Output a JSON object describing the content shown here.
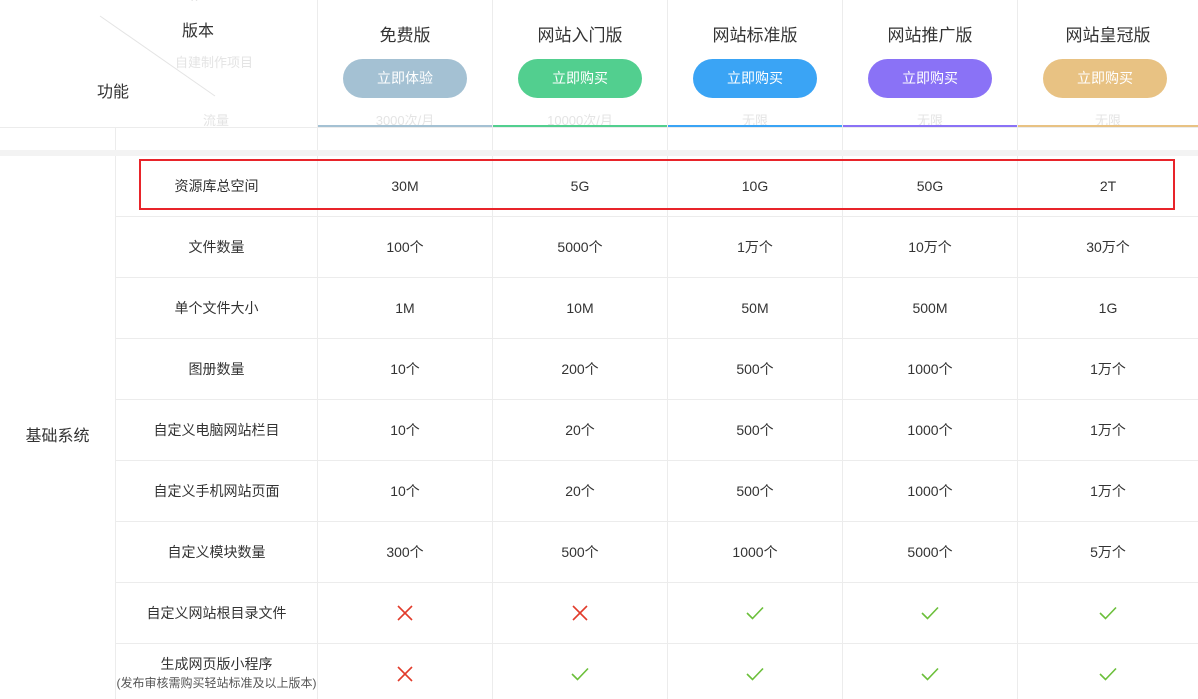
{
  "header": {
    "corner": {
      "version_label": "版本",
      "function_label": "功能",
      "ghost_text": "自建制作项目",
      "ghost_text_2": "流量"
    },
    "plans": [
      {
        "name": "免费版",
        "button": "立即体验",
        "button_color": "#a4c1d3",
        "line_color": "#a4c1d3",
        "ghost": "3000次/月"
      },
      {
        "name": "网站入门版",
        "button": "立即购买",
        "button_color": "#52cf8f",
        "line_color": "#52cf8f",
        "ghost": "10000次/月"
      },
      {
        "name": "网站标准版",
        "button": "立即购买",
        "button_color": "#3aa4f5",
        "line_color": "#3aa4f5",
        "ghost": "无限"
      },
      {
        "name": "网站推广版",
        "button": "立即购买",
        "button_color": "#8a72f6",
        "line_color": "#8a72f6",
        "ghost": "无限"
      },
      {
        "name": "网站皇冠版",
        "button": "立即购买",
        "button_color": "#e8c283",
        "line_color": "#e8c283",
        "ghost": "无限"
      }
    ]
  },
  "category": "基础系统",
  "icons": {
    "cross": "cross-icon",
    "check": "check-icon",
    "cross_color": "#e23b2b",
    "check_color": "#6bbf3a"
  },
  "highlight_color": "#e8242a",
  "rows": [
    {
      "feature": "资源库总空间",
      "values": [
        "30M",
        "5G",
        "10G",
        "50G",
        "2T"
      ]
    },
    {
      "feature": "文件数量",
      "values": [
        "100个",
        "5000个",
        "1万个",
        "10万个",
        "30万个"
      ]
    },
    {
      "feature": "单个文件大小",
      "values": [
        "1M",
        "10M",
        "50M",
        "500M",
        "1G"
      ]
    },
    {
      "feature": "图册数量",
      "values": [
        "10个",
        "200个",
        "500个",
        "1000个",
        "1万个"
      ]
    },
    {
      "feature": "自定义电脑网站栏目",
      "values": [
        "10个",
        "20个",
        "500个",
        "1000个",
        "1万个"
      ]
    },
    {
      "feature": "自定义手机网站页面",
      "values": [
        "10个",
        "20个",
        "500个",
        "1000个",
        "1万个"
      ]
    },
    {
      "feature": "自定义模块数量",
      "values": [
        "300个",
        "500个",
        "1000个",
        "5000个",
        "5万个"
      ]
    },
    {
      "feature": "自定义网站根目录文件",
      "values": [
        "cross",
        "cross",
        "check",
        "check",
        "check"
      ]
    },
    {
      "feature": "生成网页版小程序",
      "feature_sub": "(发布审核需购买轻站标准及以上版本)",
      "values": [
        "cross",
        "check",
        "check",
        "check",
        "check"
      ]
    }
  ]
}
